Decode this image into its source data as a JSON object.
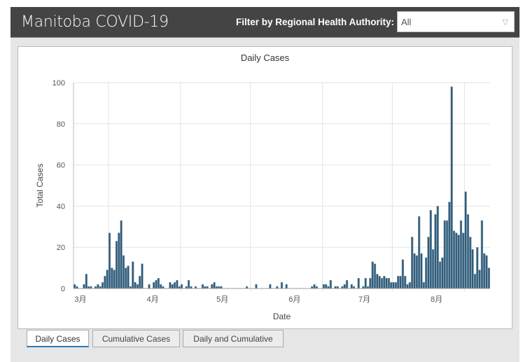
{
  "header": {
    "title": "Manitoba COVID-19",
    "filter_label": "Filter by Regional Health Authority:",
    "filter_value": "All",
    "filter_icon": "triangle-down-icon"
  },
  "tabs": [
    {
      "label": "Daily Cases",
      "active": true
    },
    {
      "label": "Cumulative Cases"
    },
    {
      "label": "Daily and Cumulative"
    }
  ],
  "chart_data": {
    "type": "bar",
    "title": "Daily Cases",
    "xlabel": "Date",
    "ylabel": "Total Cases",
    "ylim": [
      0,
      100
    ],
    "yticks": [
      0,
      20,
      40,
      60,
      80,
      100
    ],
    "grid": true,
    "bar_color": "#2d5a78",
    "start_date": "2020-03-01",
    "xticks": [
      {
        "label": "3月",
        "date": "2020-03-01"
      },
      {
        "label": "4月",
        "date": "2020-04-01"
      },
      {
        "label": "5月",
        "date": "2020-05-01"
      },
      {
        "label": "6月",
        "date": "2020-06-01"
      },
      {
        "label": "7月",
        "date": "2020-07-01"
      },
      {
        "label": "8月",
        "date": "2020-08-01"
      }
    ],
    "values": [
      2,
      1,
      0,
      0,
      2,
      7,
      1,
      1,
      0,
      1,
      2,
      1,
      3,
      6,
      9,
      27,
      10,
      9,
      23,
      27,
      33,
      16,
      10,
      11,
      1,
      13,
      3,
      2,
      6,
      12,
      0,
      0,
      2,
      0,
      3,
      4,
      5,
      2,
      1,
      0,
      0,
      3,
      2,
      3,
      4,
      1,
      2,
      0,
      1,
      4,
      1,
      0,
      1,
      0,
      0,
      2,
      1,
      1,
      0,
      2,
      3,
      1,
      1,
      1,
      0,
      0,
      0,
      0,
      0,
      0,
      0,
      0,
      0,
      0,
      1,
      0,
      0,
      0,
      2,
      0,
      0,
      0,
      0,
      0,
      2,
      0,
      0,
      1,
      0,
      3,
      0,
      2,
      0,
      0,
      0,
      0,
      0,
      0,
      0,
      0,
      0,
      0,
      1,
      2,
      1,
      0,
      0,
      2,
      2,
      1,
      4,
      0,
      1,
      1,
      0,
      1,
      2,
      4,
      0,
      2,
      1,
      0,
      5,
      0,
      1,
      5,
      1,
      5,
      13,
      12,
      7,
      6,
      5,
      6,
      5,
      5,
      3,
      3,
      3,
      6,
      6,
      14,
      6,
      2,
      3,
      25,
      17,
      16,
      35,
      17,
      3,
      15,
      25,
      38,
      19,
      36,
      40,
      13,
      15,
      33,
      33,
      42,
      98,
      28,
      27,
      26,
      33,
      27,
      47,
      36,
      25,
      19,
      7,
      20,
      9,
      33,
      17,
      16,
      10
    ]
  }
}
